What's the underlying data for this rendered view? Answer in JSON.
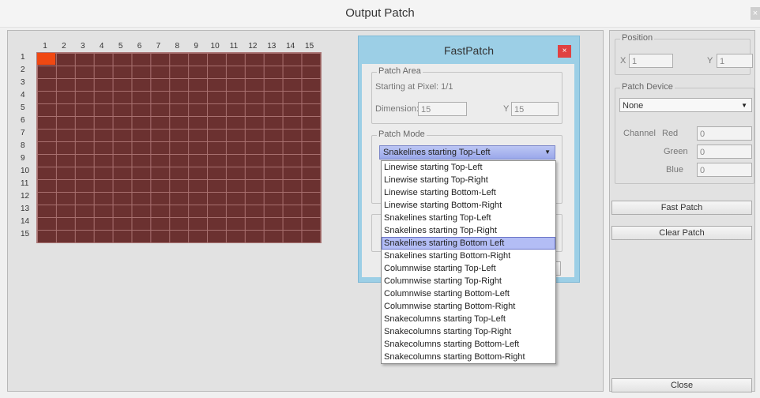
{
  "window": {
    "title": "Output Patch",
    "close_symbol": "×"
  },
  "grid": {
    "columns": [
      "1",
      "2",
      "3",
      "4",
      "5",
      "6",
      "7",
      "8",
      "9",
      "10",
      "11",
      "12",
      "13",
      "14",
      "15"
    ],
    "rows": [
      "1",
      "2",
      "3",
      "4",
      "5",
      "6",
      "7",
      "8",
      "9",
      "10",
      "11",
      "12",
      "13",
      "14",
      "15"
    ],
    "cell_color": "#6b3130",
    "active_cell_color": "#f04812"
  },
  "position": {
    "label": "Position",
    "x_label": "X",
    "x_value": "1",
    "y_label": "Y",
    "y_value": "1"
  },
  "patch_device": {
    "label": "Patch Device",
    "device_value": "None",
    "channel_label": "Channel",
    "red_label": "Red",
    "red_value": "0",
    "green_label": "Green",
    "green_value": "0",
    "blue_label": "Blue",
    "blue_value": "0"
  },
  "buttons": {
    "fast_patch": "Fast Patch",
    "clear_patch": "Clear Patch",
    "close": "Close"
  },
  "fastpatch": {
    "title": "FastPatch",
    "close_symbol": "×",
    "patch_area_label": "Patch Area",
    "starting_text": "Starting at Pixel: 1/1",
    "dimension_x_label": "Dimension: X",
    "dimension_x_value": "15",
    "dimension_y_label": "Y",
    "dimension_y_value": "15",
    "patch_mode_label": "Patch Mode",
    "patch_mode_value": "Snakelines starting Top-Left",
    "options": [
      "Linewise starting Top-Left",
      "Linewise starting Top-Right",
      "Linewise starting Bottom-Left",
      "Linewise starting Bottom-Right",
      "Snakelines starting Top-Left",
      "Snakelines starting Top-Right",
      "Snakelines starting Bottom Left",
      "Snakelines starting Bottom-Right",
      "Columnwise starting Top-Left",
      "Columnwise starting Top-Right",
      "Columnwise starting Bottom-Left",
      "Columnwise starting Bottom-Right",
      "Snakecolumns starting Top-Left",
      "Snakecolumns starting Top-Right",
      "Snakecolumns starting Bottom-Left",
      "Snakecolumns starting Bottom-Right"
    ],
    "highlighted_option": "Snakelines starting Bottom Left"
  },
  "colors": {
    "dialog_frame": "#9ccfe6",
    "close_red": "#e04141",
    "selection": "#b3bdf5"
  }
}
